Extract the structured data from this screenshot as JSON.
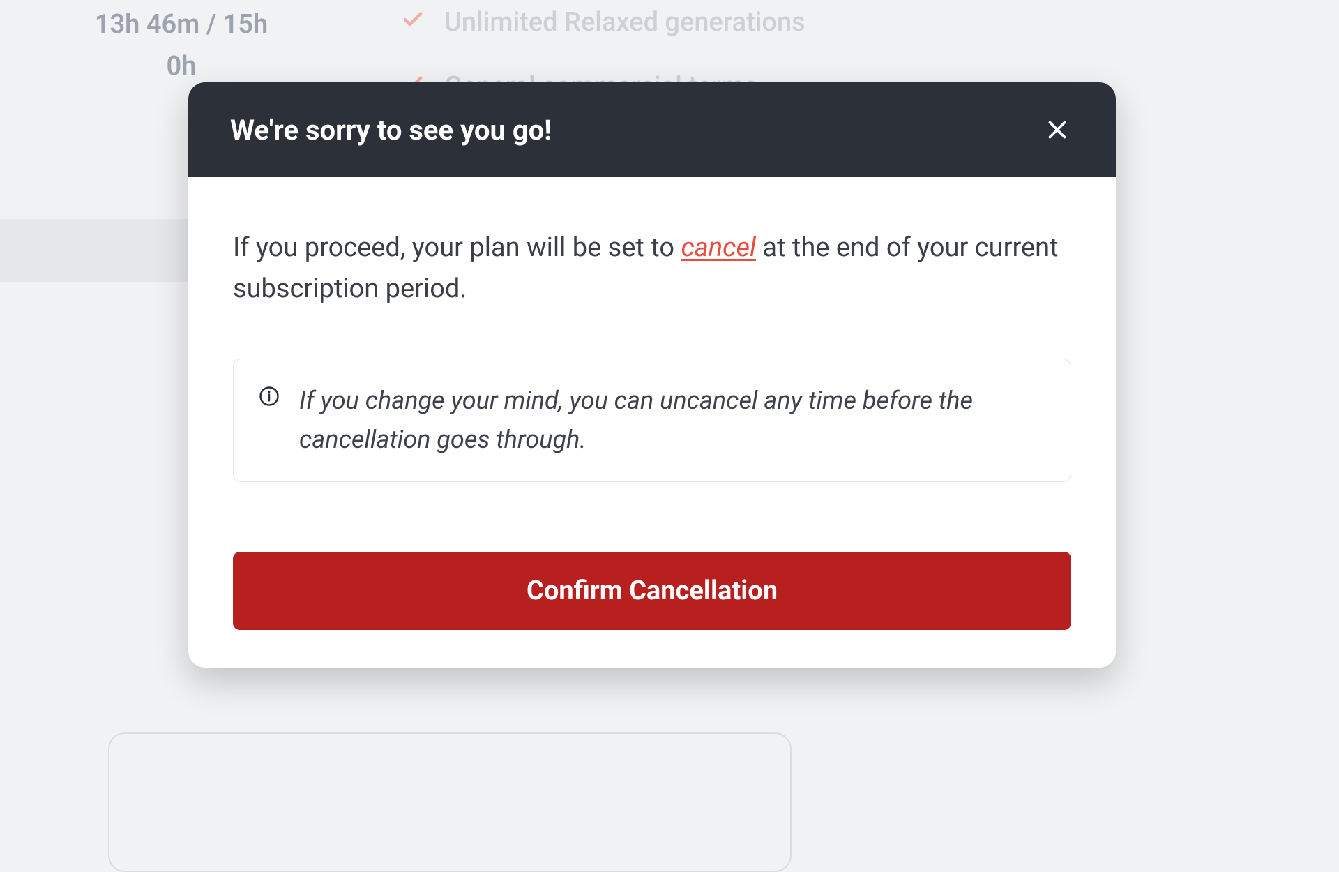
{
  "background": {
    "usage_line1": "13h 46m / 15h",
    "usage_line2": "0h",
    "features": [
      "Unlimited Relaxed generations",
      "General commercial terms"
    ]
  },
  "modal": {
    "title": "We're sorry to see you go!",
    "message_before": "If you proceed, your plan will be set to ",
    "message_cancel": "cancel",
    "message_after": " at the end of your current subscription period.",
    "info_text": "If you change your mind, you can uncancel any time before the cancellation goes through.",
    "confirm_label": "Confirm Cancellation"
  }
}
